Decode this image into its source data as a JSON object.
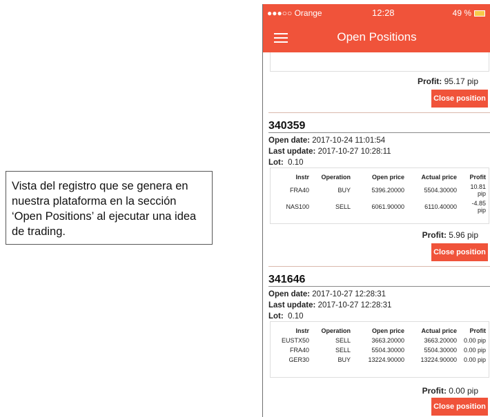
{
  "caption": {
    "text": "Vista del registro que se genera en nuestra plataforma en la sección ‘Open Positions’ al ejecutar una idea de trading."
  },
  "status_bar": {
    "carrier": "●●●○○ Orange",
    "time": "12:28",
    "battery": "49 %"
  },
  "nav": {
    "title": "Open Positions"
  },
  "labels": {
    "profit": "Profit:",
    "open_date": "Open date:",
    "last_update": "Last update:",
    "lot": "Lot:",
    "close_button": "Close position"
  },
  "table_headers": [
    "Instr",
    "Operation",
    "Open price",
    "Actual price",
    "Profit"
  ],
  "previous_position": {
    "profit": "95.17 pip"
  },
  "positions": [
    {
      "id": "340359",
      "open_date": "2017-10-24 11:01:54",
      "last_update": "2017-10-27 10:28:11",
      "lot": "0.10",
      "rows": [
        [
          "FRA40",
          "BUY",
          "5396.20000",
          "5504.30000",
          "10.81 pip"
        ],
        [
          "NAS100",
          "SELL",
          "6061.90000",
          "6110.40000",
          "-4.85 pip"
        ]
      ],
      "profit": "5.96 pip"
    },
    {
      "id": "341646",
      "open_date": "2017-10-27 12:28:31",
      "last_update": "2017-10-27 12:28:31",
      "lot": "0.10",
      "rows": [
        [
          "EUSTX50",
          "SELL",
          "3663.20000",
          "3663.20000",
          "0.00 pip"
        ],
        [
          "FRA40",
          "SELL",
          "5504.30000",
          "5504.30000",
          "0.00 pip"
        ],
        [
          "GER30",
          "BUY",
          "13224.90000",
          "13224.90000",
          "0.00 pip"
        ]
      ],
      "profit": "0.00 pip"
    }
  ]
}
